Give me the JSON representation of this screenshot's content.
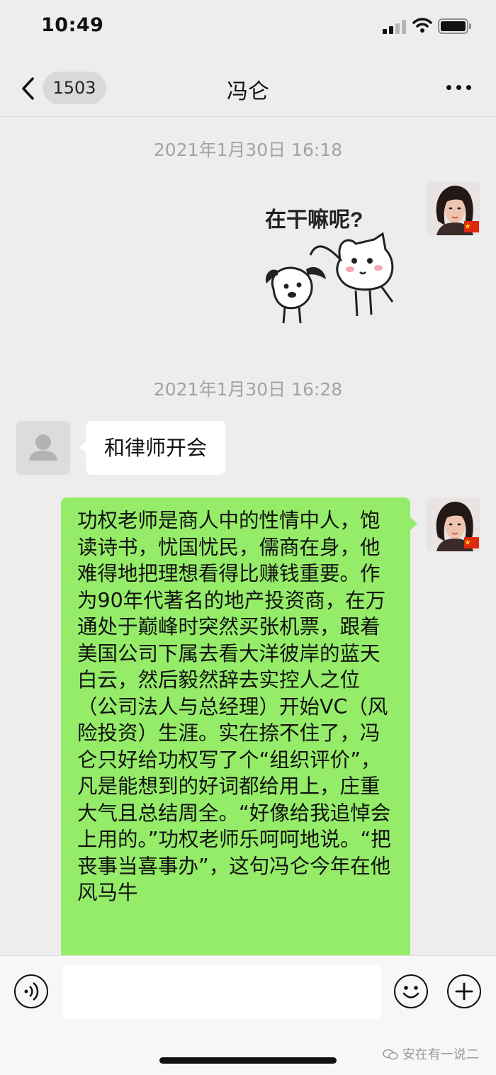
{
  "status_bar": {
    "time": "10:49"
  },
  "nav": {
    "back_count": "1503",
    "title": "冯仑",
    "more_icon": "more-dots-icon"
  },
  "messages": [
    {
      "type": "timestamp",
      "text": "2021年1月30日 16:18"
    },
    {
      "type": "sticker",
      "sender": "self",
      "caption": "在干嘛呢?"
    },
    {
      "type": "timestamp",
      "text": "2021年1月30日 16:28"
    },
    {
      "type": "text",
      "sender": "other",
      "text": "和律师开会"
    },
    {
      "type": "text",
      "sender": "self",
      "text": "功权老师是商人中的性情中人，饱读诗书，忧国忧民，儒商在身，他难得地把理想看得比赚钱重要。作为90年代著名的地产投资商，在万通处于巅峰时突然买张机票，跟着美国公司下属去看大洋彼岸的蓝天白云，然后毅然辞去实控人之位（公司法人与总经理）开始VC（风险投资）生涯。实在捺不住了，冯仑只好给功权写了个“组织评价”，凡是能想到的好词都给用上，庄重大气且总结周全。“好像给我追悼会上用的。”功权老师乐呵呵地说。“把丧事当喜事办”，这句冯仑今年在他风马牛"
    }
  ],
  "input_bar": {
    "voice_icon": "voice-icon",
    "emoji_icon": "emoji-icon",
    "plus_icon": "plus-icon",
    "input_value": ""
  },
  "watermark": "安在有一说二",
  "colors": {
    "background": "#ededed",
    "self_bubble": "#95ec69",
    "other_bubble": "#ffffff",
    "timestamp": "#a3a3a3",
    "flag_red": "#de2910",
    "flag_yellow": "#ffde00"
  }
}
